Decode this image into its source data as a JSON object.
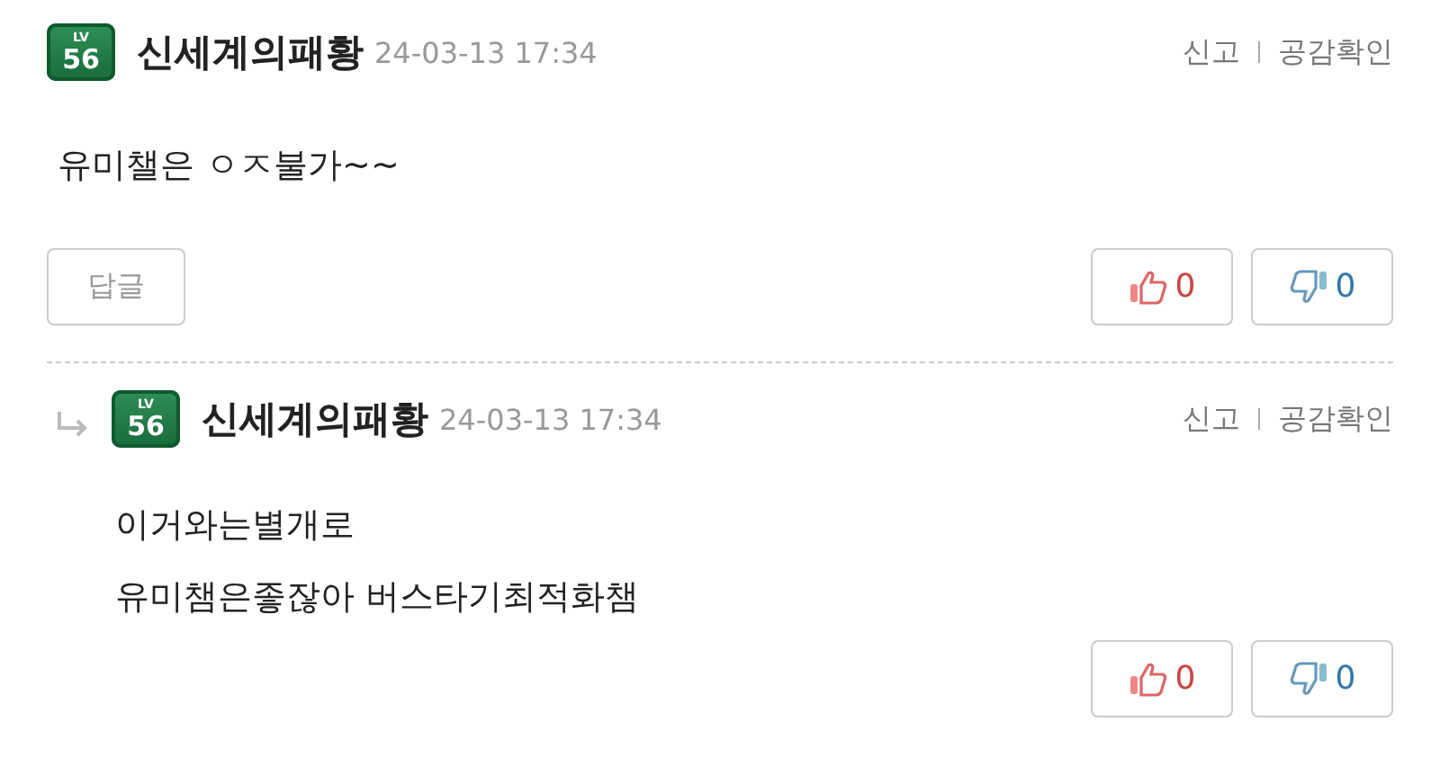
{
  "comments": [
    {
      "kind": "comment",
      "level_label": "LV",
      "level": "56",
      "author": "신세계의패황",
      "date": "24-03-13 17:34",
      "report": "신고",
      "likes_check": "공감확인",
      "body": [
        "유미챌은 ㅇㅈ불가~~"
      ],
      "reply_button": "답글",
      "up": "0",
      "down": "0"
    },
    {
      "kind": "reply",
      "level_label": "LV",
      "level": "56",
      "author": "신세계의패황",
      "date": "24-03-13 17:34",
      "report": "신고",
      "likes_check": "공감확인",
      "body": [
        "이거와는별개로",
        "유미챔은좋잖아 버스타기최적화챔"
      ],
      "up": "0",
      "down": "0"
    }
  ]
}
